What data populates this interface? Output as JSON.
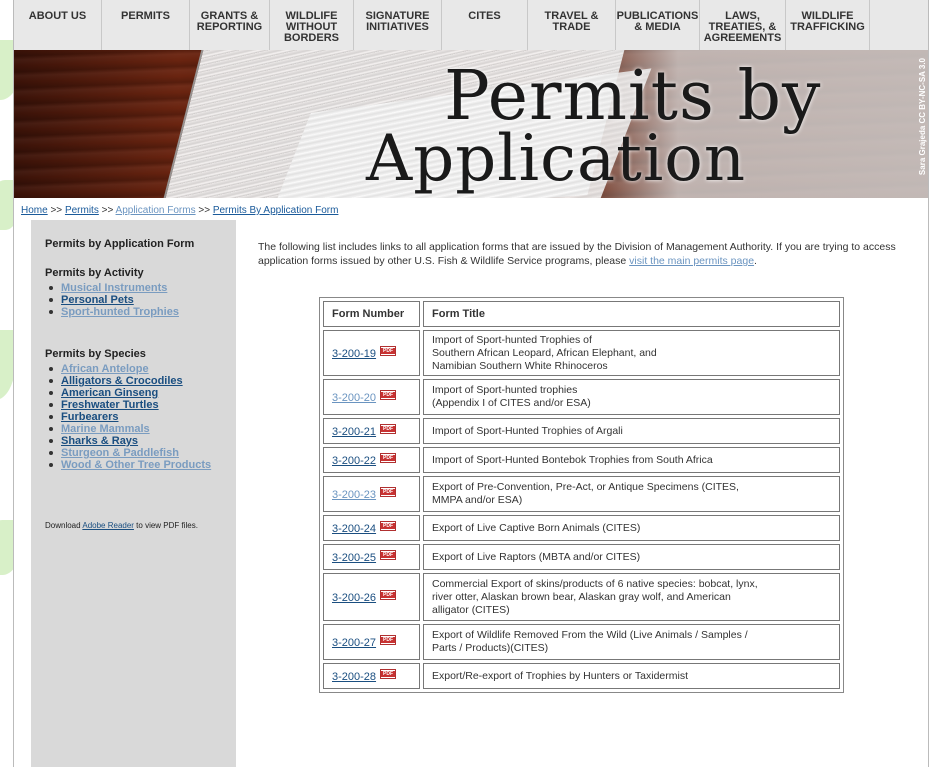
{
  "nav": [
    {
      "label": "ABOUT US",
      "w": 88
    },
    {
      "label": "PERMITS",
      "w": 88
    },
    {
      "label": "GRANTS &\nREPORTING",
      "w": 80
    },
    {
      "label": "WILDLIFE\nWITHOUT\nBORDERS",
      "w": 84
    },
    {
      "label": "SIGNATURE\nINITIATIVES",
      "w": 88
    },
    {
      "label": "CITES",
      "w": 86
    },
    {
      "label": "TRAVEL &\nTRADE",
      "w": 88
    },
    {
      "label": "PUBLICATIONS\n& MEDIA",
      "w": 84
    },
    {
      "label": "LAWS,\nTREATIES, &\nAGREEMENTS",
      "w": 86
    },
    {
      "label": "WILDLIFE\nTRAFFICKING",
      "w": 84
    }
  ],
  "banner": {
    "title_line1": "Permits by",
    "title_line2": "Application Form",
    "credit": "Sara Grajeda CC BY-NC-SA 3.0"
  },
  "breadcrumb": {
    "home": "Home",
    "sep": ">>",
    "permits": "Permits",
    "application_forms": "Application Forms",
    "current": "Permits By Application Form"
  },
  "sidebar": {
    "title": "Permits by Application Form",
    "activity_heading": "Permits by Activity",
    "activity_items": [
      {
        "label": "Musical Instruments",
        "visited": true
      },
      {
        "label": "Personal Pets",
        "visited": false
      },
      {
        "label": "Sport-hunted Trophies",
        "visited": true
      }
    ],
    "species_heading": "Permits by Species",
    "species_items": [
      {
        "label": "African Antelope",
        "visited": true
      },
      {
        "label": "Alligators & Crocodiles",
        "visited": false
      },
      {
        "label": "American Ginseng",
        "visited": false
      },
      {
        "label": "Freshwater Turtles",
        "visited": false
      },
      {
        "label": "Furbearers",
        "visited": false
      },
      {
        "label": "Marine Mammals",
        "visited": true
      },
      {
        "label": "Sharks & Rays",
        "visited": false
      },
      {
        "label": "Sturgeon & Paddlefish",
        "visited": true
      },
      {
        "label": "Wood & Other Tree Products",
        "visited": true
      }
    ],
    "download_prefix": "Download ",
    "download_link": "Adobe Reader",
    "download_suffix": " to view PDF files."
  },
  "intro": {
    "text": "The following list includes links to all application forms that are issued by the Division of Management Authority.  If you are trying to access application forms issued by other U.S. Fish & Wildlife Service programs, please ",
    "link": "visit the main permits page",
    "end": "."
  },
  "table": {
    "headers": [
      "Form Number",
      "Form Title"
    ],
    "rows": [
      {
        "number": "3-200-19",
        "visited": false,
        "title": "Import of Sport-hunted Trophies of\nSouthern African Leopard, African Elephant, and\nNamibian Southern White Rhinoceros",
        "h": 46
      },
      {
        "number": "3-200-20",
        "visited": true,
        "title": "Import of Sport-hunted trophies\n(Appendix I of CITES and/or ESA)",
        "h": 36
      },
      {
        "number": "3-200-21",
        "visited": false,
        "title": "Import of Sport-Hunted Trophies of Argali",
        "h": 26
      },
      {
        "number": "3-200-22",
        "visited": false,
        "title": "Import of Sport-Hunted Bontebok Trophies from South Africa",
        "h": 26
      },
      {
        "number": "3-200-23",
        "visited": true,
        "title": "Export of Pre-Convention, Pre-Act, or Antique Specimens (CITES,\nMMPA and/or ESA)",
        "h": 36
      },
      {
        "number": "3-200-24",
        "visited": false,
        "title": "Export of Live Captive Born Animals (CITES)",
        "h": 26
      },
      {
        "number": "3-200-25",
        "visited": false,
        "title": "Export of Live Raptors (MBTA and/or CITES)",
        "h": 26
      },
      {
        "number": "3-200-26",
        "visited": false,
        "title": "Commercial Export of skins/products of 6 native species: bobcat, lynx,\nriver otter, Alaskan brown bear, Alaskan gray wolf, and American\nalligator (CITES)",
        "h": 48
      },
      {
        "number": "3-200-27",
        "visited": false,
        "title": "Export of Wildlife Removed From the Wild (Live Animals / Samples /\nParts / Products)(CITES)",
        "h": 36
      },
      {
        "number": "3-200-28",
        "visited": false,
        "title": "Export/Re-export of Trophies by Hunters or Taxidermist",
        "h": 26
      }
    ]
  }
}
